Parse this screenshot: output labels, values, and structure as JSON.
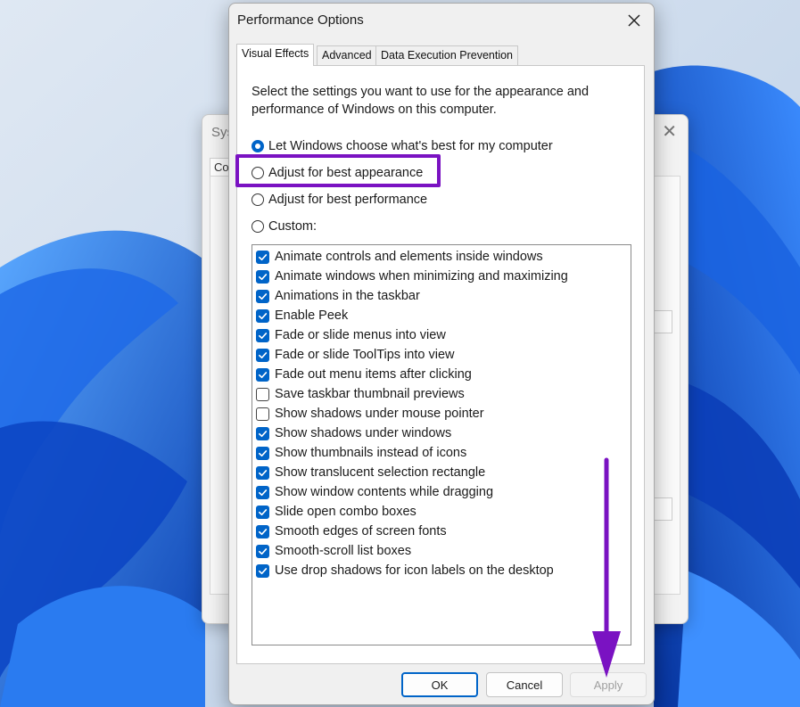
{
  "background_window": {
    "title_fragment": "Sys",
    "tab_fragment": "Co"
  },
  "dialog": {
    "title": "Performance Options",
    "close_icon": "close-icon",
    "tabs": [
      {
        "label": "Visual Effects",
        "active": true
      },
      {
        "label": "Advanced",
        "active": false
      },
      {
        "label": "Data Execution Prevention",
        "active": false
      }
    ],
    "description": "Select the settings you want to use for the appearance and performance of Windows on this computer.",
    "radio_options": [
      {
        "label": "Let Windows choose what's best for my computer",
        "checked": true
      },
      {
        "label": "Adjust for best appearance",
        "checked": false
      },
      {
        "label": "Adjust for best performance",
        "checked": false
      },
      {
        "label": "Custom:",
        "checked": false
      }
    ],
    "effects": [
      {
        "label": "Animate controls and elements inside windows",
        "checked": true
      },
      {
        "label": "Animate windows when minimizing and maximizing",
        "checked": true
      },
      {
        "label": "Animations in the taskbar",
        "checked": true
      },
      {
        "label": "Enable Peek",
        "checked": true
      },
      {
        "label": "Fade or slide menus into view",
        "checked": true
      },
      {
        "label": "Fade or slide ToolTips into view",
        "checked": true
      },
      {
        "label": "Fade out menu items after clicking",
        "checked": true
      },
      {
        "label": "Save taskbar thumbnail previews",
        "checked": false
      },
      {
        "label": "Show shadows under mouse pointer",
        "checked": false
      },
      {
        "label": "Show shadows under windows",
        "checked": true
      },
      {
        "label": "Show thumbnails instead of icons",
        "checked": true
      },
      {
        "label": "Show translucent selection rectangle",
        "checked": true
      },
      {
        "label": "Show window contents while dragging",
        "checked": true
      },
      {
        "label": "Slide open combo boxes",
        "checked": true
      },
      {
        "label": "Smooth edges of screen fonts",
        "checked": true
      },
      {
        "label": "Smooth-scroll list boxes",
        "checked": true
      },
      {
        "label": "Use drop shadows for icon labels on the desktop",
        "checked": true
      }
    ],
    "buttons": {
      "ok": "OK",
      "cancel": "Cancel",
      "apply": "Apply"
    }
  },
  "annotations": {
    "highlight_color": "#7a12c2",
    "arrow_color": "#7a12c2"
  }
}
